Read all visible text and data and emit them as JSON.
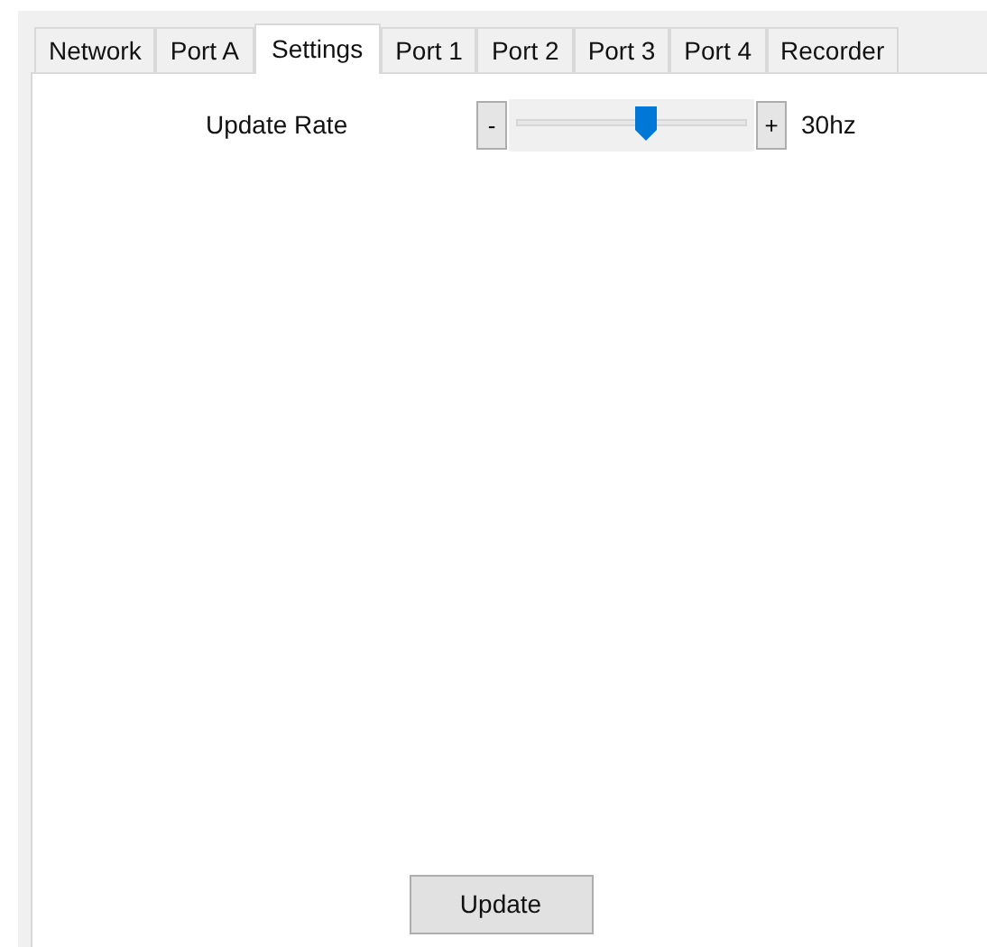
{
  "tabs": [
    {
      "label": "Network",
      "selected": false
    },
    {
      "label": "Port A",
      "selected": false
    },
    {
      "label": "Settings",
      "selected": true
    },
    {
      "label": "Port 1",
      "selected": false
    },
    {
      "label": "Port 2",
      "selected": false
    },
    {
      "label": "Port 3",
      "selected": false
    },
    {
      "label": "Port 4",
      "selected": false
    },
    {
      "label": "Recorder",
      "selected": false
    }
  ],
  "settings": {
    "label": "Update Rate",
    "decrease": "-",
    "increase": "+",
    "level": 0.57,
    "reading": "30hz"
  },
  "buttons": [
    "Update"
  ]
}
